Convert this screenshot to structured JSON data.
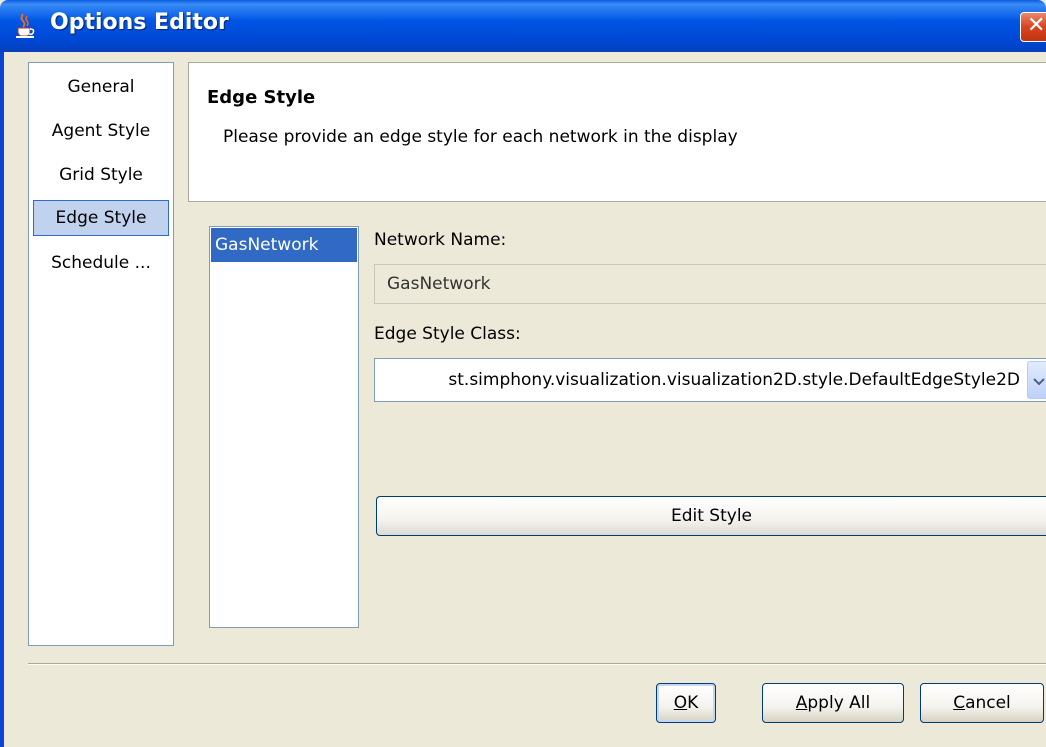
{
  "window": {
    "title": "Options Editor",
    "close_symbol": "✕",
    "icon": "java-cup-icon"
  },
  "nav": {
    "items": [
      {
        "label": "General",
        "selected": false
      },
      {
        "label": "Agent Style",
        "selected": false
      },
      {
        "label": "Grid Style",
        "selected": false
      },
      {
        "label": "Edge Style",
        "selected": true
      },
      {
        "label": "Schedule ...",
        "selected": false
      }
    ]
  },
  "header": {
    "title": "Edge Style",
    "description": "Please provide an edge style for each network in the display"
  },
  "networks": {
    "items": [
      "GasNetwork"
    ],
    "selected": "GasNetwork"
  },
  "form": {
    "network_name_label": "Network Name:",
    "network_name_value": "GasNetwork",
    "edge_style_class_label": "Edge Style Class:",
    "edge_style_class_value": "st.simphony.visualization.visualization2D.style.DefaultEdgeStyle2D",
    "edit_style_label": "Edit Style"
  },
  "buttons": {
    "ok_mnemonic": "O",
    "ok_rest": "K",
    "apply_mnemonic": "A",
    "apply_rest": "pply All",
    "cancel_mnemonic": "C",
    "cancel_rest": "ancel"
  },
  "colors": {
    "titlebar": "#0055e5",
    "selection": "#316ac5",
    "nav_selection": "#c1d2ee",
    "dialog_bg": "#ece9d8"
  }
}
